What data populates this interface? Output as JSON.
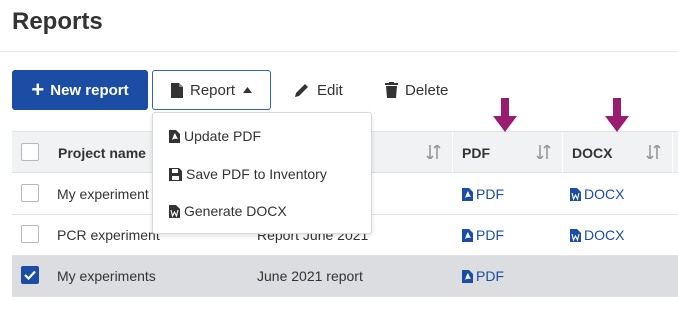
{
  "header": {
    "title": "Reports"
  },
  "toolbar": {
    "new_report_label": "New report",
    "report_label": "Report",
    "edit_label": "Edit",
    "delete_label": "Delete"
  },
  "report_menu": {
    "items": [
      {
        "label": "Update PDF",
        "icon": "pdf-file-icon"
      },
      {
        "label": "Save PDF to Inventory",
        "icon": "save-icon"
      },
      {
        "label": "Generate DOCX",
        "icon": "word-file-icon"
      }
    ]
  },
  "table": {
    "columns": [
      "Project name",
      "",
      "PDF",
      "DOCX"
    ],
    "rows": [
      {
        "project": "My experiment",
        "report": "",
        "pdf": "PDF",
        "docx": "DOCX",
        "checked": false
      },
      {
        "project": "PCR experiment",
        "report": "Report June 2021",
        "pdf": "PDF",
        "docx": "DOCX",
        "checked": false
      },
      {
        "project": "My experiments",
        "report": "June 2021 report",
        "pdf": "PDF",
        "docx": "",
        "checked": true
      }
    ]
  },
  "colors": {
    "primary": "#1a4da3",
    "selected_row": "#dcdde1",
    "header_bg": "#f1f2f4",
    "annotation_arrow": "#9b1b6e"
  }
}
